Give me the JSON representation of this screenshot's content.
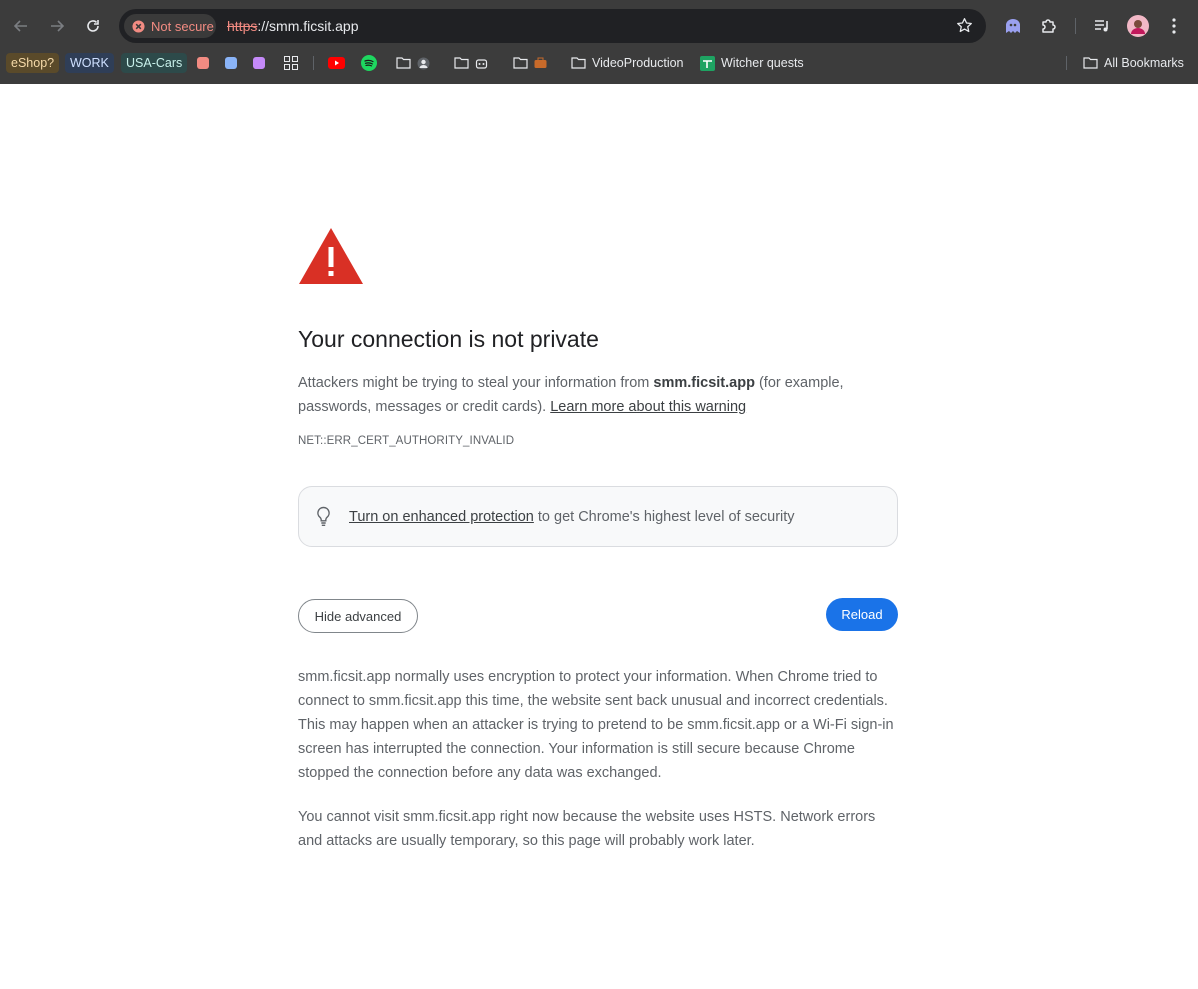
{
  "browser": {
    "security_chip": "Not secure",
    "url_scheme": "https",
    "url_rest": "://smm.ficsit.app",
    "bookmarks": {
      "eshop": "eShop?",
      "work": "WORK",
      "usa_cars": "USA-Cars",
      "video_production": "VideoProduction",
      "witcher_quests": "Witcher quests",
      "all_bookmarks": "All Bookmarks"
    },
    "colors": {
      "toolbar": "#3c3c3c",
      "omnibox": "#202124",
      "danger": "#f28b82"
    }
  },
  "page": {
    "title": "Your connection is not private",
    "lead_prefix": "Attackers might be trying to steal your information from ",
    "lead_domain": "smm.ficsit.app",
    "lead_suffix": " (for example, passwords, messages or credit cards). ",
    "learn_more": "Learn more about this warning",
    "error_code": "NET::ERR_CERT_AUTHORITY_INVALID",
    "enhanced_link": "Turn on enhanced protection",
    "enhanced_suffix": " to get Chrome's highest level of security",
    "hide_advanced": "Hide advanced",
    "reload": "Reload",
    "details_1": "smm.ficsit.app normally uses encryption to protect your information. When Chrome tried to connect to smm.ficsit.app this time, the website sent back unusual and incorrect credentials. This may happen when an attacker is trying to pretend to be smm.ficsit.app or a Wi-Fi sign-in screen has interrupted the connection. Your information is still secure because Chrome stopped the connection before any data was exchanged.",
    "details_2": "You cannot visit smm.ficsit.app right now because the website uses HSTS. Network errors and attacks are usually temporary, so this page will probably work later.",
    "colors": {
      "warning_red": "#d93025",
      "primary_blue": "#1a73e8"
    }
  }
}
